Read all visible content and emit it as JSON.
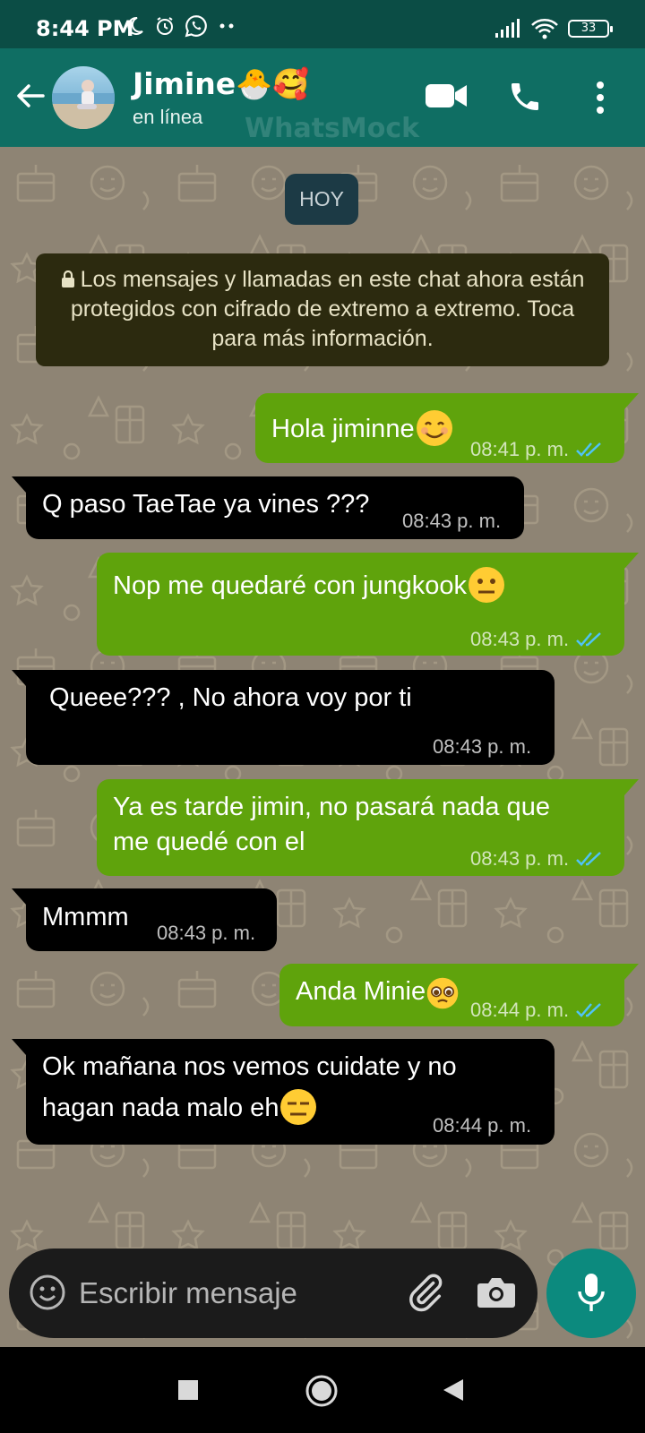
{
  "status_bar": {
    "time": "8:44 PM",
    "icons_left": [
      "moon-icon",
      "alarm-icon",
      "whatsapp-icon",
      "dots-icon"
    ],
    "icons_right": [
      "signal-icon",
      "wifi-icon",
      "battery-icon"
    ],
    "battery": "33"
  },
  "header": {
    "contact_name": "Jimine🐣🥰",
    "status": "en línea",
    "watermark": "WhatsMock",
    "icons": [
      "back-arrow-icon",
      "video-call-icon",
      "phone-call-icon",
      "more-options-icon"
    ]
  },
  "chat": {
    "date_chip": "HOY",
    "encryption_notice": "Los mensajes y llamadas en este chat ahora están protegidos con cifrado de extremo a extremo. Toca para más información.",
    "messages": [
      {
        "direction": "out",
        "text": "Hola jiminne",
        "emoji": "😊",
        "time": "08:41 p. m.",
        "read": true
      },
      {
        "direction": "in",
        "text": "Q paso TaeTae ya vines ???",
        "time": "08:43 p. m."
      },
      {
        "direction": "out",
        "text": "Nop me quedaré con jungkook",
        "emoji": "😐",
        "time": "08:43 p. m.",
        "read": true
      },
      {
        "direction": "in",
        "text": " Queee??? , No ahora voy por ti",
        "time": "08:43 p. m."
      },
      {
        "direction": "out",
        "text_line1": "Ya es tarde jimin, no pasará nada que",
        "text_line2": "me quedé con el",
        "time": "08:43 p. m.",
        "read": true
      },
      {
        "direction": "in",
        "text": "Mmmm",
        "time": "08:43 p. m."
      },
      {
        "direction": "out",
        "text": "Anda Minie",
        "emoji": "🥺",
        "time": "08:44 p. m.",
        "read": true
      },
      {
        "direction": "in",
        "text_line1": "Ok mañana nos vemos cuidate y no",
        "text_line2": "hagan nada malo eh",
        "emoji": "😑",
        "time": "08:44 p. m."
      }
    ]
  },
  "input": {
    "placeholder": "Escribir mensaje",
    "icons": [
      "emoji-icon",
      "attach-icon",
      "camera-icon",
      "mic-icon"
    ]
  },
  "nav_bar": {
    "icons": [
      "recents-square-icon",
      "home-circle-icon",
      "back-triangle-icon"
    ]
  },
  "colors": {
    "status_bar": "#0b4d45",
    "header": "#0f6e63",
    "chat_background": "#8e8474",
    "outgoing_bubble": "#5fa30c",
    "incoming_bubble": "#000000",
    "read_ticks": "#4fc3f7",
    "mic_button": "#0c8a7e"
  }
}
